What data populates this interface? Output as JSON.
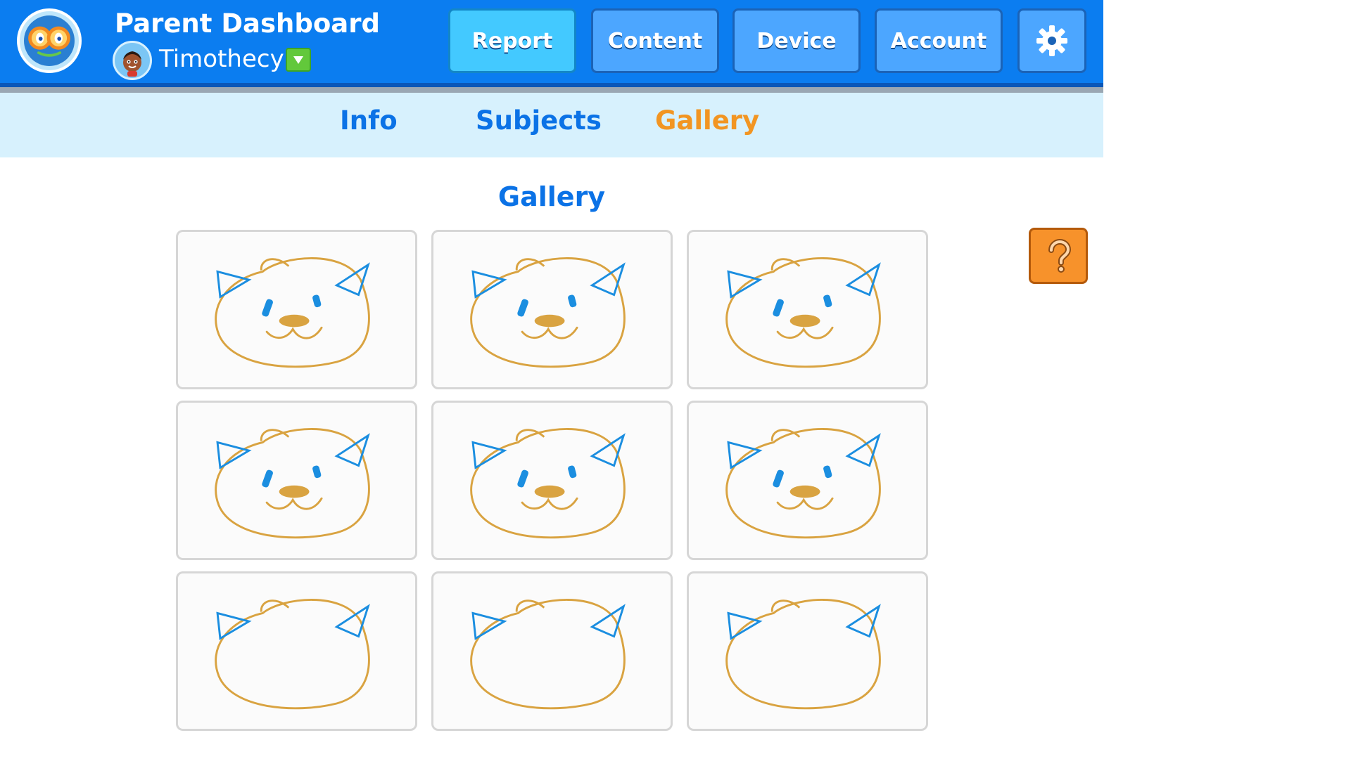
{
  "header": {
    "title": "Parent Dashboard",
    "username": "Timothecy"
  },
  "nav": [
    {
      "label": "Report",
      "active": true
    },
    {
      "label": "Content",
      "active": false
    },
    {
      "label": "Device",
      "active": false
    },
    {
      "label": "Account",
      "active": false
    }
  ],
  "subtabs": [
    {
      "label": "Info",
      "active": false
    },
    {
      "label": "Subjects",
      "active": false
    },
    {
      "label": "Gallery",
      "active": true
    }
  ],
  "page_title": "Gallery",
  "colors": {
    "header_blue": "#0b7df0",
    "tab_blue": "#0b72e6",
    "active_orange": "#f29522",
    "drawing_orange": "#d9a341",
    "drawing_blue": "#1b8ee0"
  },
  "icons": {
    "logo": "app-logo-icon",
    "dropdown": "chevron-down-icon",
    "settings": "gear-icon",
    "help": "question-icon"
  }
}
